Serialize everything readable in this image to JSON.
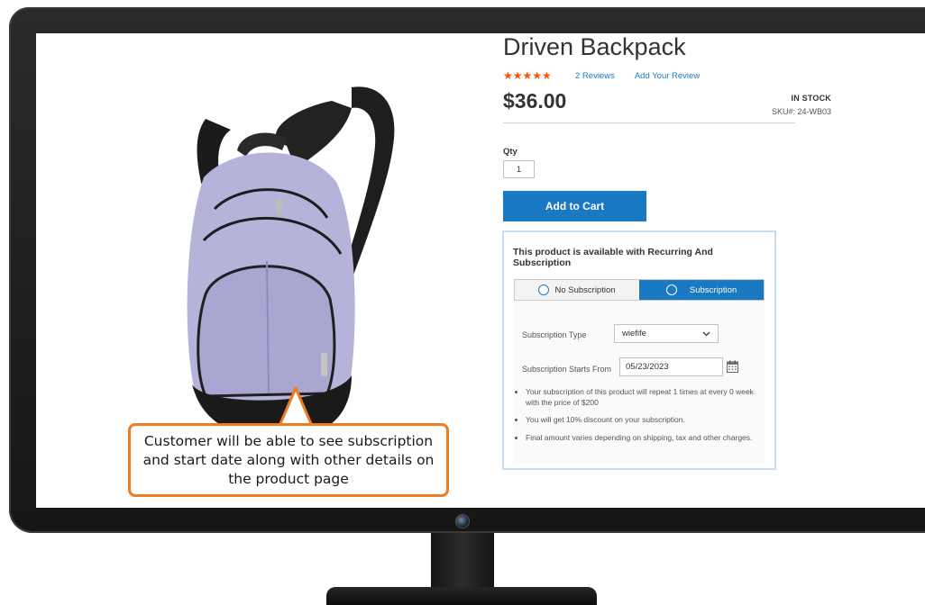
{
  "product": {
    "title": "Driven Backpack",
    "rating_fraction": 0.9,
    "reviews_link": "2  Reviews",
    "add_review_link": "Add Your Review",
    "price": "$36.00",
    "stock": "IN STOCK",
    "sku": "SKU#:  24-WB03",
    "qty_label": "Qty",
    "qty_value": "1",
    "add_to_cart": "Add to Cart"
  },
  "subscription": {
    "header": "This product is available with Recurring And Subscription",
    "tabs": [
      {
        "label": "No Subscription",
        "active": false
      },
      {
        "label": "Subscription",
        "active": true
      }
    ],
    "type_label": "Subscription Type",
    "type_value": "wiefife",
    "start_label": "Subscription Starts From",
    "start_value": "05/23/2023",
    "info": [
      "Your subscription of this product will repeat 1 times at every 0 week with the price of $200",
      "You will get 10% discount on your subscription.",
      "Final amount varies depending on shipping, tax and other charges."
    ]
  },
  "callout": {
    "text": "Customer will be able to see subscription and start date along with other details on the product page"
  },
  "icons": {
    "stars": "star-rating-icon",
    "calendar": "calendar-icon",
    "dropdown": "chevron-down-icon"
  },
  "colors": {
    "accent": "#1979c3",
    "star": "#ff5501",
    "callout_border": "#f07a1e"
  }
}
